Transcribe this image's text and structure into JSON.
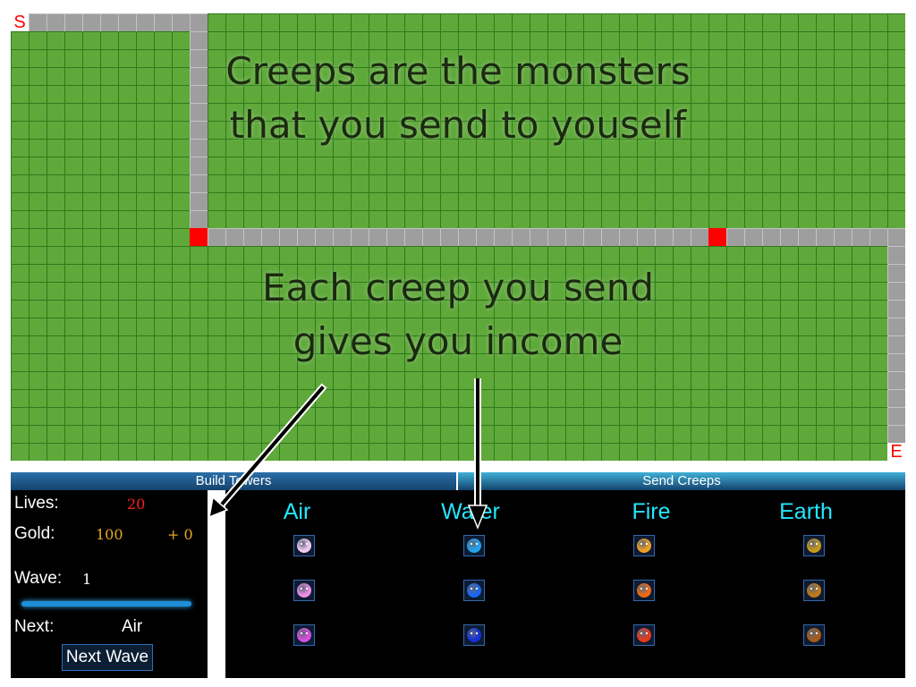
{
  "board": {
    "start_label": "S",
    "end_label": "E",
    "overlay_line1": "Creeps are the monsters",
    "overlay_line2": "that you send to youself",
    "overlay_line3": "Each creep you send",
    "overlay_line4": "gives you income"
  },
  "tabs": {
    "build": "Build Towers",
    "send": "Send  Creeps"
  },
  "stats": {
    "lives_label": "Lives:",
    "lives_value": "20",
    "gold_label": "Gold:",
    "gold_value": "100",
    "gold_income": "+ 0",
    "wave_label": "Wave:",
    "wave_value": "1",
    "next_label": "Next:",
    "next_value": "Air",
    "next_wave_button": "Next Wave"
  },
  "creeps": {
    "columns": [
      {
        "title": "Air",
        "colors": [
          "#f6c9f2",
          "#ee8ce8",
          "#d94ee0"
        ]
      },
      {
        "title": "Water",
        "colors": [
          "#20a4f0",
          "#1a66f0",
          "#1430d8"
        ]
      },
      {
        "title": "Fire",
        "colors": [
          "#f0a020",
          "#f06a14",
          "#e83818"
        ]
      },
      {
        "title": "Earth",
        "colors": [
          "#c89818",
          "#c07a14",
          "#a85a14"
        ]
      }
    ]
  },
  "colors": {
    "grass": "#5fa83a",
    "path": "#9e9e9e",
    "accent_cyan": "#22e8ff",
    "lives": "#ff2020",
    "gold": "#e8a820"
  }
}
